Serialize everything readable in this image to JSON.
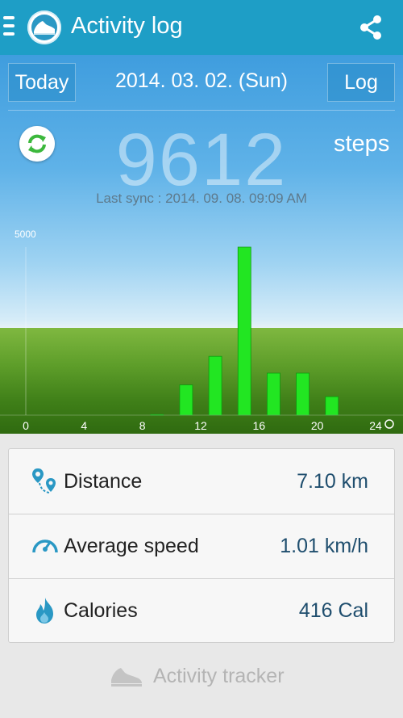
{
  "app": {
    "title": "Activity log",
    "accent": "#1e9ec6"
  },
  "header": {
    "today_label": "Today",
    "date": "2014. 03. 02. (Sun)",
    "log_label": "Log"
  },
  "summary": {
    "steps": "9612",
    "steps_unit": "steps",
    "last_sync": "Last sync : 2014. 09. 08. 09:09 AM"
  },
  "chart_data": {
    "type": "bar",
    "y_top_label": "5000",
    "ylim": [
      0,
      5000
    ],
    "x_ticks": [
      "0",
      "4",
      "8",
      "12",
      "16",
      "20",
      "24"
    ],
    "x": [
      9,
      11,
      13,
      15,
      17,
      19,
      21
    ],
    "values": [
      20,
      900,
      1750,
      5000,
      1250,
      1250,
      550
    ],
    "bar_color": "#22e622"
  },
  "stats": [
    {
      "label": "Distance",
      "value": "7.10 km",
      "icon": "location-route-icon"
    },
    {
      "label": "Average speed",
      "value": "1.01 km/h",
      "icon": "speedometer-icon"
    },
    {
      "label": "Calories",
      "value": "416 Cal",
      "icon": "flame-icon"
    }
  ],
  "footer": {
    "label": "Activity tracker",
    "icon": "shoe-icon"
  }
}
